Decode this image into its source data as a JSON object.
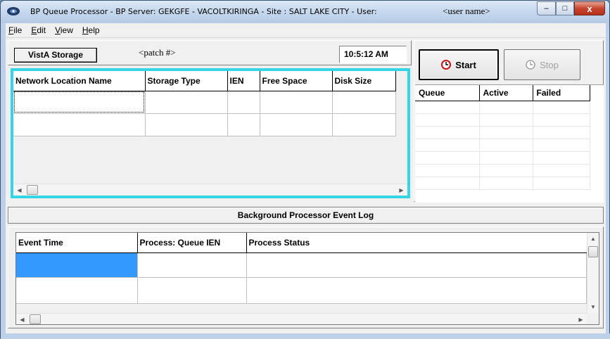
{
  "window": {
    "title": "BP Queue Processor    -    BP Server: GEKGFE - VACOLTKIRINGA  -  Site :  SALT LAKE CITY   -    User:",
    "user": "<user name>",
    "minimize": "–",
    "maximize": "□",
    "close": "x"
  },
  "menu": [
    {
      "key": "F",
      "rest": "ile"
    },
    {
      "key": "E",
      "rest": "dit"
    },
    {
      "key": "V",
      "rest": "iew"
    },
    {
      "key": "H",
      "rest": "elp"
    }
  ],
  "header": {
    "storage_label": "VistA Storage",
    "patch": "<patch #>",
    "clock": "10:5:12 AM"
  },
  "storage_grid": {
    "columns": [
      "Network Location Name",
      "Storage Type",
      "IEN",
      "Free Space",
      "Disk Size"
    ],
    "rows": [
      [
        "",
        "",
        "",
        "",
        ""
      ],
      [
        "",
        "",
        "",
        "",
        ""
      ]
    ]
  },
  "controls": {
    "start_label": "Start",
    "stop_label": "Stop"
  },
  "queue_grid": {
    "columns": [
      "Queue",
      "Active",
      "Failed"
    ]
  },
  "event_log": {
    "title": "Background Processor Event Log",
    "columns": [
      "Event Time",
      "Process: Queue IEN",
      "Process Status"
    ],
    "rows": [
      [
        "",
        "",
        ""
      ],
      [
        "",
        "",
        ""
      ]
    ]
  },
  "scroll_arrows": {
    "left": "◀",
    "right": "▶",
    "up": "▲",
    "down": "▼"
  },
  "colors": {
    "grid_focus_border": "#34d6e6",
    "selection": "#3399ff",
    "start_icon": "#d01010"
  }
}
